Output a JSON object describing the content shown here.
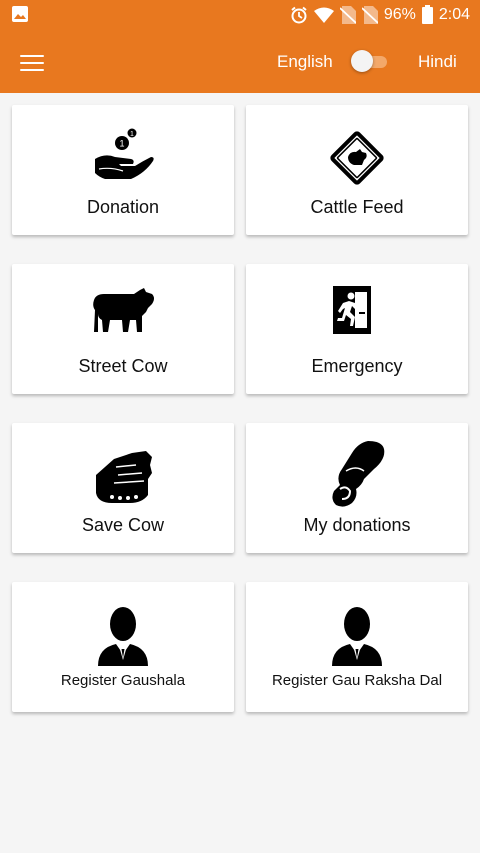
{
  "status_bar": {
    "battery": "96%",
    "time": "2:04",
    "icons": [
      "image-icon",
      "alarm-icon",
      "wifi-icon",
      "no-sim-icon",
      "no-sim-icon",
      "battery-icon"
    ]
  },
  "app_bar": {
    "menu_icon": "hamburger-menu-icon",
    "lang_left": "English",
    "lang_right": "Hindi",
    "toggle_state": "off",
    "color": "#e8781f"
  },
  "grid": {
    "items": [
      {
        "label": "Donation",
        "icon": "donation-hand-icon"
      },
      {
        "label": "Cattle Feed",
        "icon": "cattle-feed-sign-icon"
      },
      {
        "label": "Street Cow",
        "icon": "cow-icon"
      },
      {
        "label": "Emergency",
        "icon": "emergency-exit-icon"
      },
      {
        "label": "Save Cow",
        "icon": "save-hand-icon"
      },
      {
        "label": "My donations",
        "icon": "my-donations-hand-icon"
      },
      {
        "label": "Register Gaushala",
        "icon": "person-icon"
      },
      {
        "label": "Register Gau Raksha Dal",
        "icon": "person-icon"
      }
    ]
  }
}
